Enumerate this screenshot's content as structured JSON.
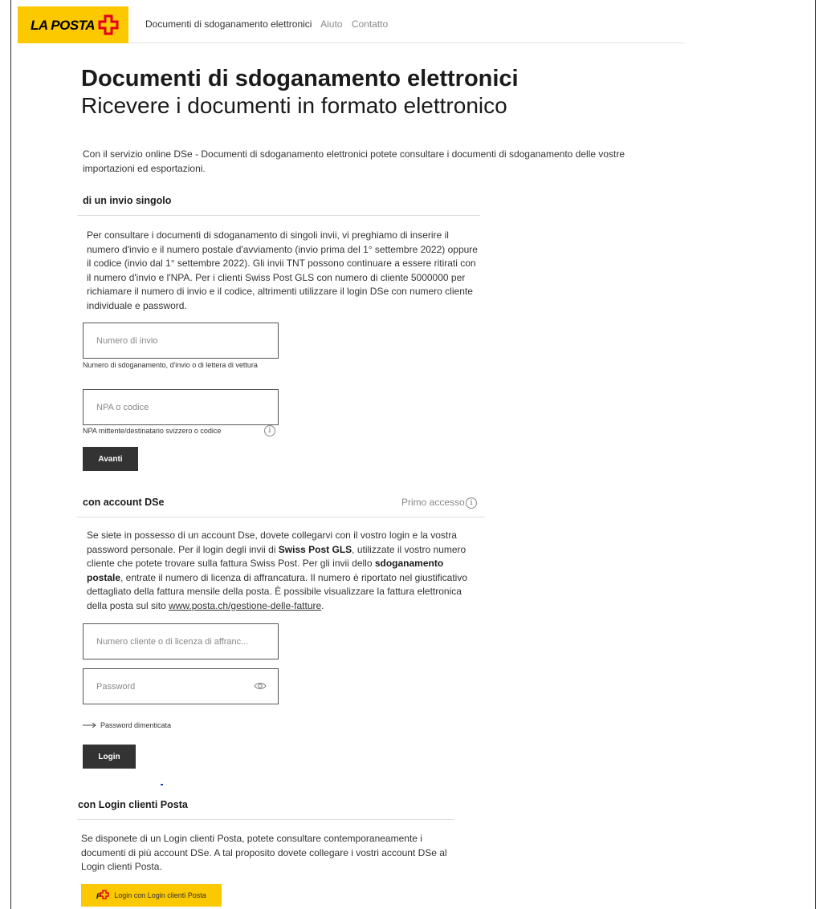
{
  "header": {
    "logo_text": "LA POSTA",
    "nav": [
      "Documenti di sdoganamento elettronici",
      "Aiuto",
      "Contatto"
    ]
  },
  "page": {
    "title": "Documenti di sdoganamento elettronici",
    "subtitle": "Ricevere i documenti in formato elettronico",
    "intro": "Con il servizio online DSe - Documenti di sdoganamento elettronici potete consultare i documenti di sdoganamento delle vostre importazioni ed esportazioni."
  },
  "single": {
    "title": "di un invio singolo",
    "text": "Per consultare i documenti di sdoganamento di singoli invii, vi preghiamo di inserire il numero d'invio e il numero postale d'avviamento (invio prima del 1° settembre 2022) oppure il codice (invio dal 1° settembre 2022). Gli invii TNT possono continuare a essere ritirati con il numero d'invio e l'NPA. Per i clienti Swiss Post GLS con numero di cliente 5000000 per richiamare il numero di invio e il codice, altrimenti utilizzare il login DSe con numero cliente individuale e password.",
    "shipment_placeholder": "Numero di invio",
    "shipment_hint": "Numero di sdoganamento, d'invio o di lettera di vettura",
    "npa_placeholder": "NPA o codice",
    "npa_hint": "NPA mittente/destinatario svizzero o codice",
    "info_glyph": "i",
    "submit_label": "Avanti"
  },
  "account": {
    "title": "con account DSe",
    "first_access": "Primo accesso",
    "info_glyph": "i",
    "text_1": "Se siete in possesso di un account Dse, dovete collegarvi con il vostro login e la vostra password personale. Per il login degli invii di ",
    "bold_1": "Swiss Post GLS",
    "text_2": ", utilizzate il vostro numero cliente che potete trovare sulla fattura Swiss Post. Per gli invii dello ",
    "bold_2": "sdoganamento postale",
    "text_3": ", entrate il numero di licenza di affrancatura. Il numero è riportato nel giustificativo dettagliato della fattura mensile della posta. È possibile visualizzare la fattura elettronica della posta sul sito ",
    "link": "www.posta.ch/gestione-delle-fatture",
    "text_4": ".",
    "customer_placeholder": "Numero cliente o di licenza di affranc...",
    "password_placeholder": "Password",
    "eye_icon": "eye-icon",
    "forgot_label": "Password dimenticata",
    "login_label": "Login"
  },
  "post_login": {
    "title": "con Login clienti Posta",
    "text": "Se disponete di un Login clienti Posta, potete consultare contemporaneamente i documenti di più account DSe. A tal proposito dovete collegare i vostri account DSe al Login clienti Posta.",
    "button_label": "Login con Login clienti Posta"
  },
  "colors": {
    "brand_yellow": "#fcc800",
    "brand_red": "#e2001a",
    "button_dark": "#333333"
  }
}
